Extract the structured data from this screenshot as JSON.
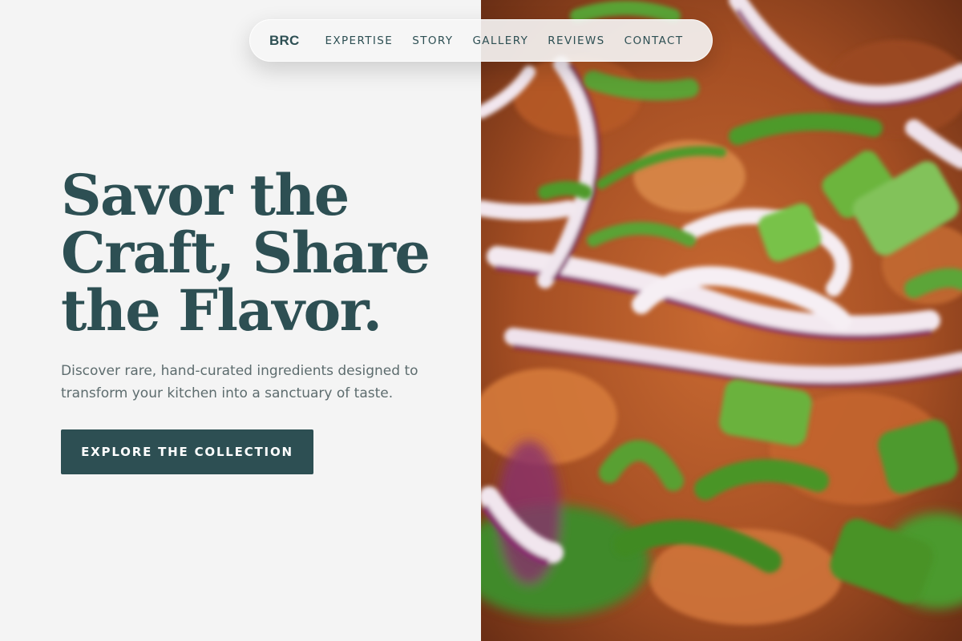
{
  "nav": {
    "logo": "BRC",
    "links": [
      "EXPERTISE",
      "STORY",
      "GALLERY",
      "REVIEWS",
      "CONTACT"
    ]
  },
  "hero": {
    "title_lines": [
      "Savor the",
      "Craft, Share",
      "the Flavor."
    ],
    "subtitle_lines": [
      "Discover rare, hand-curated ingredients designed to",
      "transform your kitchen into a sanctuary of taste."
    ],
    "cta_label": "EXPLORE THE COLLECTION"
  },
  "image": {
    "subject": "close-up of a dish topped with red onion rings and sliced green onions"
  },
  "colors": {
    "accent": "#2d4f53",
    "background": "#f4f4f4",
    "body_text": "#5d6c6e",
    "button_text": "#ffffff"
  }
}
